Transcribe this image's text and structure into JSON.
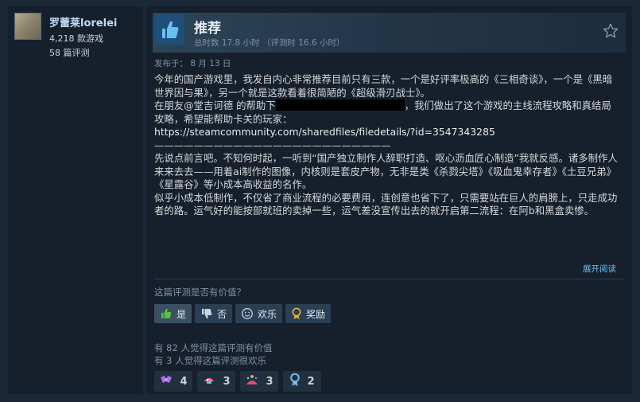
{
  "author": {
    "name": "罗蕾莱lorelei",
    "games": "4,218 款游戏",
    "reviews": "58 篇评测"
  },
  "review": {
    "verdict": "推荐",
    "hours": "总时数 17.8 小时 （评测时 16.6 小时）",
    "posted": "发布于： 8 月 13 日",
    "paragraphs": {
      "p1": "今年的国产游戏里，我发自内心非常推荐目前只有三款，一个是好评率极高的《三相奇谈》，一个是《黑暗世界因与果》，另一个就是这款看着很简陋的《超级滑刃战士》。",
      "p2a": "在朋友@堂吉诃德 的帮助下",
      "p2b": "，我们做出了这个游戏的主线流程攻略和真结局攻略，希望能帮助卡关的玩家：",
      "link": "https://steamcommunity.com/sharedfiles/filedetails/?id=3547343285",
      "dashes": "————————————————————————",
      "p3": "先说点前言吧。不知何时起，一听到“国产独立制作人辞职打造、呕心沥血匠心制造”我就反感。诸多制作人来来去去——用着ai制作的图像，内核则是套皮产物，无非是类《杀戮尖塔》《吸血鬼幸存者》《土豆兄弟》《星露谷》等小成本高收益的名作。",
      "p4": "似乎小成本低制作，不仅省了商业流程的必要费用，连创意也省下了，只需要站在巨人的肩膀上，只走成功者的路。运气好的能按部就班的卖掉一些，运气差没宣传出去的就开启第二流程：在阿b和黑盒卖惨。"
    },
    "expand": "展开阅读",
    "helpful_question": "这篇评测是否有价值？",
    "buttons": {
      "yes": "是",
      "no": "否",
      "funny": "欢乐",
      "award": "奖励"
    },
    "helpful_count": "有 82 人觉得这篇评测有价值",
    "funny_count": "有 3 人觉得这篇评测很欢乐",
    "awards": [
      "4",
      "3",
      "3",
      "2"
    ]
  },
  "icons": {
    "thumb": "thumbs-up-icon",
    "star": "star-icon"
  },
  "colors": {
    "background": "#1b2838",
    "panel": "#16202d",
    "accent": "#66c0f4",
    "thumb_box": "#1f4e78"
  }
}
